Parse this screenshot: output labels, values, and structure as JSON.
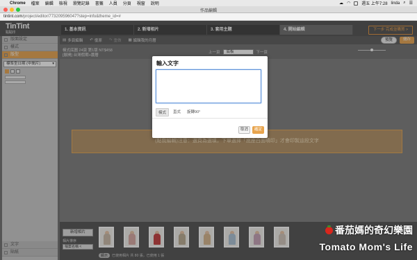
{
  "menubar": {
    "app": "Chrome",
    "items": [
      "檔案",
      "編輯",
      "檢視",
      "瀏覽記錄",
      "書籤",
      "人員",
      "分頁",
      "視窗",
      "說明"
    ],
    "clock": "週五 上午7:28",
    "user": "linda"
  },
  "window": {
    "title": "作品編輯"
  },
  "url": {
    "host": "tintint.com",
    "path": "/project/editor/773209596047?step=info&theme_id=#"
  },
  "app": {
    "logo": "TinTint",
    "logo_sub": "點點印",
    "steps": [
      "1. 基本資訊",
      "2. 新增相片",
      "3. 套用主題",
      "4. 開始編輯"
    ],
    "active_step": 3,
    "next_button": "下一步 完成並購買 >"
  },
  "sidebar": {
    "items": [
      "版面設定",
      "樣式",
      "版型"
    ],
    "active_item": 2,
    "select": "標準型日期 (中間片)",
    "bottom_items": [
      "文字",
      "貼紙"
    ]
  },
  "toolbar": {
    "items": [
      "多頁編輯",
      "復原",
      "重做",
      "編輯我的月曆"
    ],
    "preview": "預覽",
    "save": "儲存"
  },
  "info": {
    "line1": "橫式底圖 24頁 第1版 NT$458",
    "line2": "[展開] 台灣假期+農曆"
  },
  "pagenav": {
    "prev": "上一頁",
    "page": "底板",
    "next": "下一頁"
  },
  "banner": {
    "text": "(點我編輯)注意：選頁為選填，下單選擇「底座白面噴印」才會印製這段文字"
  },
  "dialog": {
    "title": "輸入文字",
    "input_value": "",
    "tabs": [
      "橫式",
      "直式",
      "旋轉90°"
    ],
    "active_tab": 0,
    "cancel": "取消",
    "ok": "確定"
  },
  "thumbbar": {
    "add_photo": "新增相片",
    "sort_label": "相片排序",
    "sort_value": "檔案名稱 <",
    "toggle": "顯示",
    "count_text": "已使用相片  共 80 張，已使用 1 張"
  },
  "watermark": {
    "line1": "番茄媽的奇幻樂園",
    "line2": "Tomato Mom's Life"
  },
  "colors": {
    "accent": "#e8a44d",
    "header_bg": "#4d4d4d",
    "canvas_bg": "#7b7b7b"
  }
}
